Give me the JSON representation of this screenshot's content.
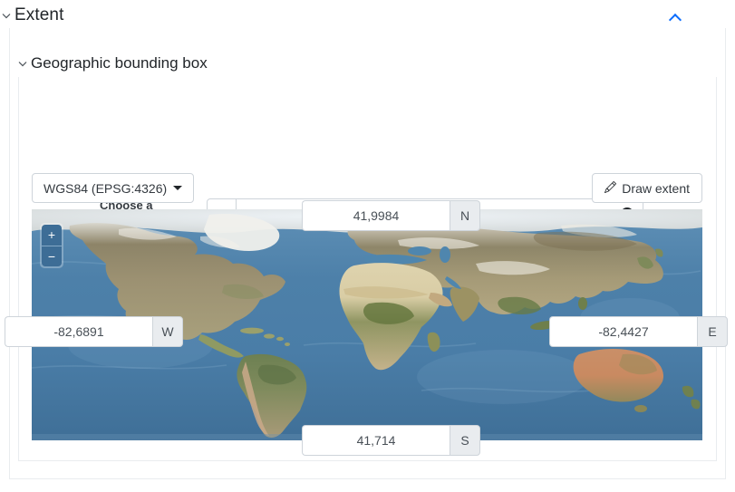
{
  "panel": {
    "title": "Extent",
    "collapse_icon": "chevron-up-icon",
    "expand_caret": "chevron-down-icon"
  },
  "section": {
    "title": "Geographic bounding box",
    "caret": "chevron-down-icon"
  },
  "region": {
    "label": "Choose a region",
    "placeholder": "Choose a region",
    "value": "",
    "dropdown_icon": "caret-down-icon",
    "clear_icon": "clear-circle-icon"
  },
  "map_toolbar": {
    "crs_label": "WGS84 (EPSG:4326)",
    "crs_caret": "caret-down-icon",
    "draw_label": "Draw extent",
    "draw_icon": "pencil-icon"
  },
  "map": {
    "zoom_in_label": "+",
    "zoom_out_label": "−",
    "zoom_in_icon": "plus-icon",
    "zoom_out_icon": "minus-icon",
    "basemap": "satellite-world-imagery"
  },
  "bounds": {
    "north": {
      "value": "41,9984",
      "addon": "N"
    },
    "south": {
      "value": "41,714",
      "addon": "S"
    },
    "west": {
      "value": "-82,6891",
      "addon": "W"
    },
    "east": {
      "value": "-82,4427",
      "addon": "E"
    }
  },
  "colors": {
    "accent": "#0d6efd",
    "border": "#ced4da",
    "panel_border": "#e9ecef",
    "addon_bg": "#e9ecef",
    "ocean": "#4f82ab",
    "zoom_btn": "#3d6d96",
    "text": "#343a40"
  }
}
